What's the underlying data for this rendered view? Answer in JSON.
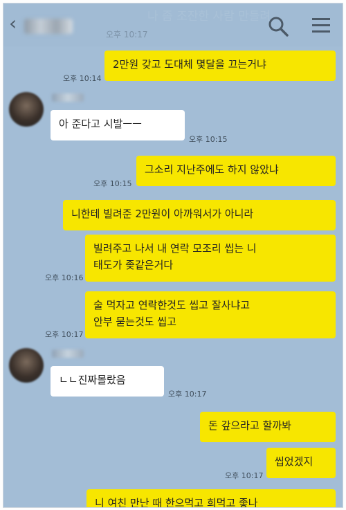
{
  "header": {
    "back_icon": "chevron-left-icon",
    "ghost_preview": "나 좀 조잔한 사람 만들려",
    "ghost_time": "오후 10:17"
  },
  "messages": [
    {
      "side": "me",
      "text": "2만원 갖고 도대체 몇달을 끄는거냐",
      "time": "오후 10:14"
    },
    {
      "side": "them",
      "text": "아 준다고 시발ㅡㅡ",
      "time": "오후 10:15"
    },
    {
      "side": "me",
      "text": "그소리 지난주에도 하지 않았냐",
      "time": "오후 10:15"
    },
    {
      "side": "me",
      "text": "니한테 빌려준 2만원이 아까워서가 아니라",
      "time": ""
    },
    {
      "side": "me",
      "text": "빌려주고 나서 내 연락 모조리 씹는 니\n태도가 좆같은거다",
      "time": "오후 10:16"
    },
    {
      "side": "me",
      "text": "술 먹자고 연락한것도 씹고 잘사냐고\n안부 묻는것도 씹고",
      "time": "오후 10:17"
    },
    {
      "side": "them",
      "text": "ㄴㄴ진짜몰랐음",
      "time": "오후 10:17"
    },
    {
      "side": "me",
      "text": "돈 갚으라고 할까봐",
      "time": ""
    },
    {
      "side": "me",
      "text": "씹었겠지",
      "time": "오후 10:17"
    },
    {
      "side": "me",
      "text": "니 여친 만난 때 한으먹고 희먹고 좋나",
      "time": ""
    }
  ],
  "colors": {
    "chat_bg": "#a3bdd6",
    "my_bubble": "#f7e600",
    "their_bubble": "#ffffff"
  }
}
